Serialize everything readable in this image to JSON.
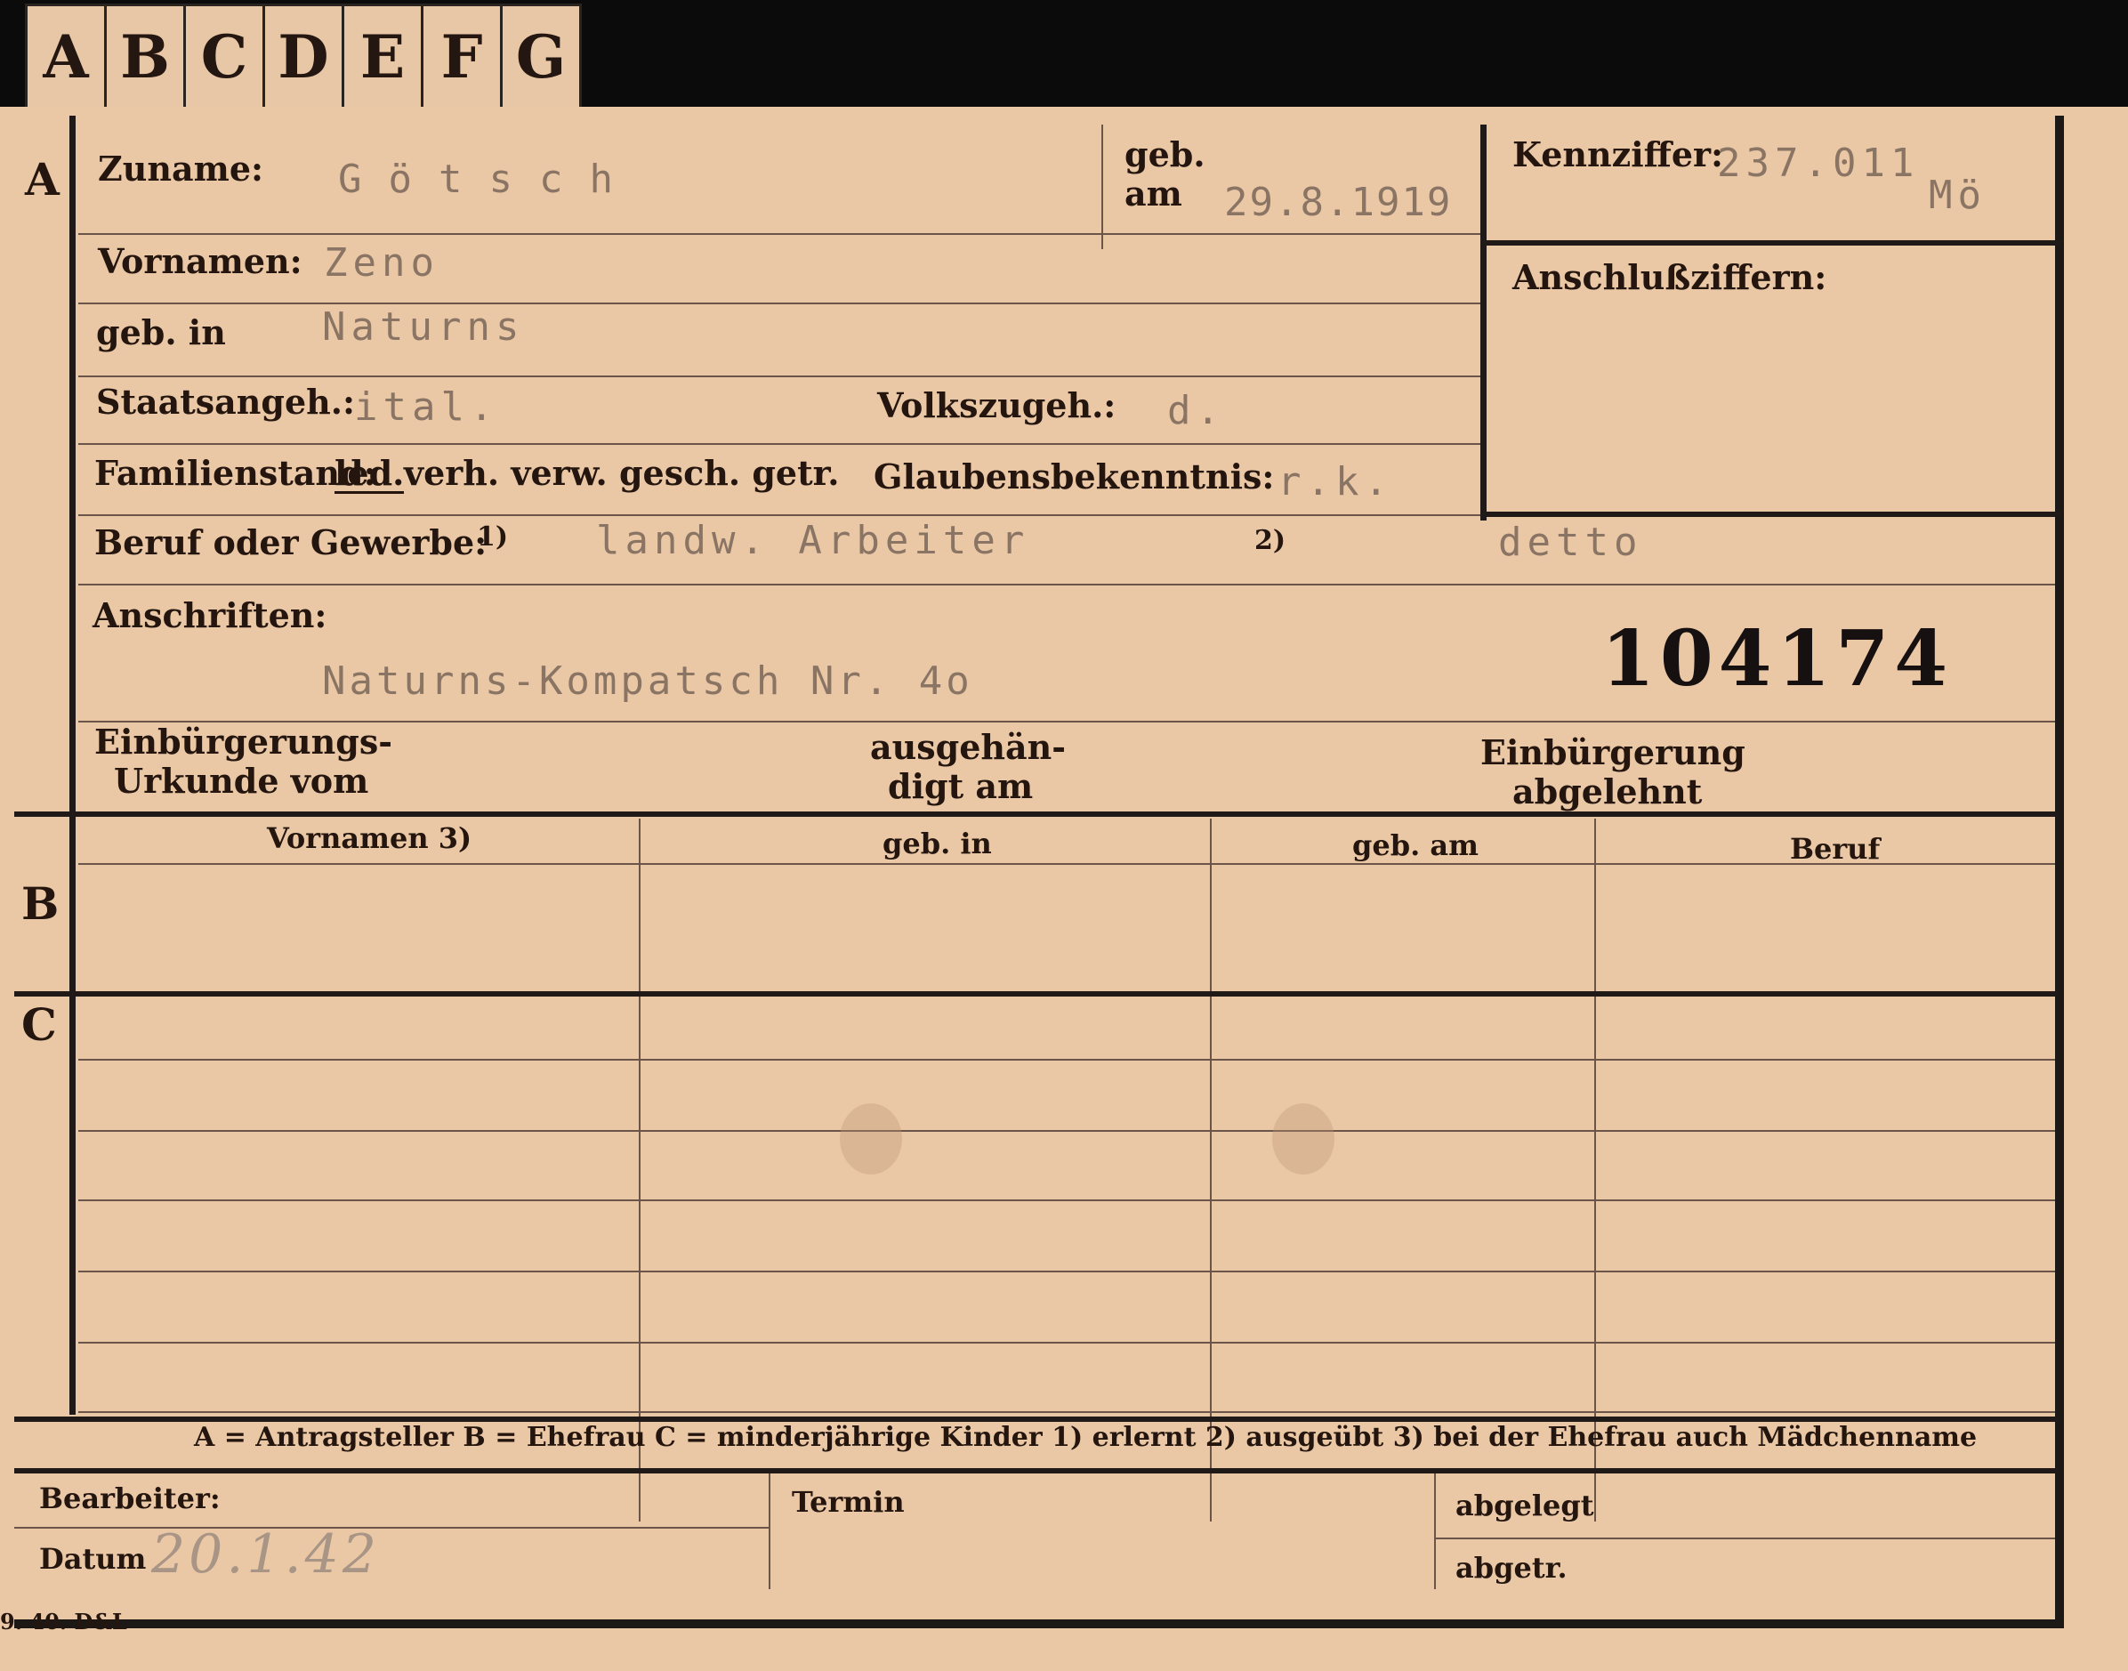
{
  "tabs": [
    "A",
    "B",
    "C",
    "D",
    "E",
    "F",
    "G"
  ],
  "sections": {
    "a": "A",
    "b": "B",
    "c": "C"
  },
  "section_a": {
    "surname_label": "Zuname:",
    "surname_value": "Götsch",
    "birth_label": "geb.",
    "birth_label2": "am",
    "birth_value": "29.8.1919",
    "id_label": "Kennziffer:",
    "id_value": "237.011",
    "id_suffix": "Mö",
    "vornamen_label": "Vornamen:",
    "vornamen_value": "Zeno",
    "birthplace_label": "geb. in",
    "birthplace_value": "Naturns",
    "anschluss_label": "Anschlußziffern:",
    "staat_label": "Staatsangeh.:",
    "staat_value": "ital.",
    "volk_label": "Volkszugeh.:",
    "volk_value": "d.",
    "familienstand_label": "Familienstand:",
    "familienstand_selected": "led.",
    "familienstand_options": "verh. verw. gesch. getr.",
    "glaube_label": "Glaubensbekenntnis:",
    "glaube_value": "r.k.",
    "beruf_label": "Beruf oder Gewerbe:",
    "beruf_mark1": "1)",
    "beruf_value1": "landw. Arbeiter",
    "beruf_mark2": "2)",
    "beruf_value2": "detto",
    "anschriften_label": "Anschriften:",
    "anschriften_value": "Naturns-Kompatsch Nr. 4o",
    "register_number": "104174",
    "einb_label1": "Einbürgerungs-",
    "einb_label2": "Urkunde vom",
    "ausgeh_label1": "ausgehän-",
    "ausgeh_label2": "digt am",
    "abgelehnt_label1": "Einbürgerung",
    "abgelehnt_label2": "abgelehnt"
  },
  "table_headers": [
    "Vornamen 3)",
    "geb. in",
    "geb. am",
    "Beruf"
  ],
  "legend": "A = Antragsteller   B = Ehefrau   C = minderjährige Kinder   1) erlernt   2) ausgeübt   3) bei der Ehefrau auch Mädchenname",
  "footer": {
    "bearbeiter_label": "Bearbeiter:",
    "datum_label": "Datum",
    "datum_value": "20.1.42",
    "termin_label": "Termin",
    "abgelegt_label": "abgelegt",
    "abget_label": "abgetr."
  },
  "print_code": "9. 40. D&L"
}
